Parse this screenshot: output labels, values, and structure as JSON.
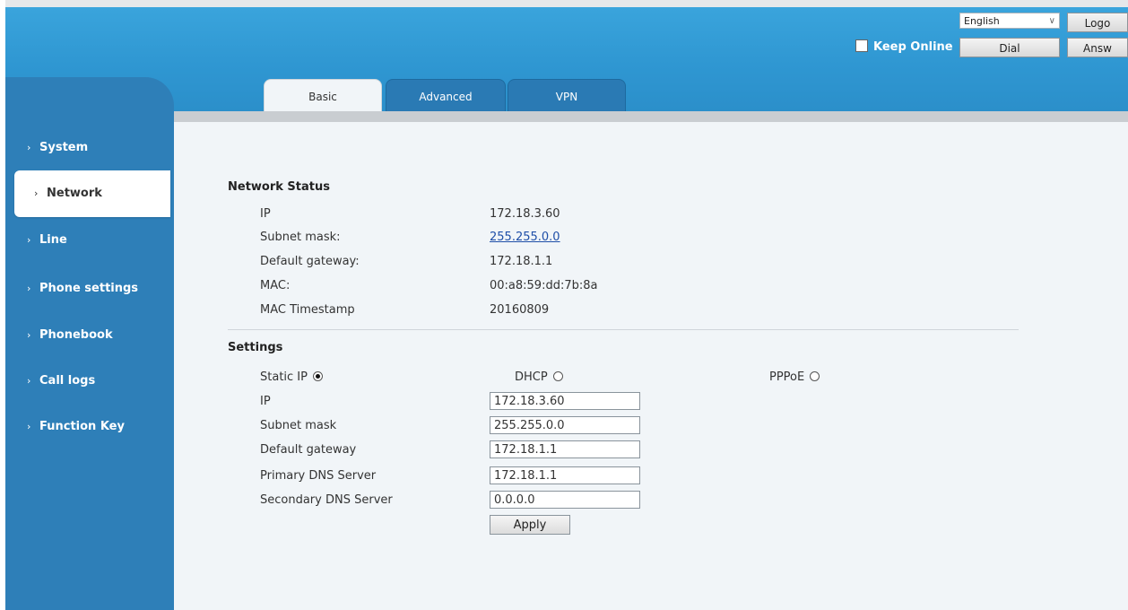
{
  "header": {
    "language": "English",
    "logout_label": "Logo",
    "dial_label": "Dial",
    "answer_label": "Answ",
    "keep_online_label": "Keep Online"
  },
  "tabs": [
    {
      "label": "Basic",
      "active": true
    },
    {
      "label": "Advanced",
      "active": false
    },
    {
      "label": "VPN",
      "active": false
    }
  ],
  "sidebar": {
    "items": [
      {
        "label": "System",
        "active": false
      },
      {
        "label": "Network",
        "active": true
      },
      {
        "label": "Line",
        "active": false
      },
      {
        "label": "Phone settings",
        "active": false
      },
      {
        "label": "Phonebook",
        "active": false
      },
      {
        "label": "Call logs",
        "active": false
      },
      {
        "label": "Function Key",
        "active": false
      }
    ]
  },
  "network_status": {
    "title": "Network Status",
    "rows": [
      {
        "label": "IP",
        "value": "172.18.3.60"
      },
      {
        "label": "Subnet mask:",
        "value": "255.255.0.0"
      },
      {
        "label": "Default gateway:",
        "value": "172.18.1.1"
      },
      {
        "label": "MAC:",
        "value": "00:a8:59:dd:7b:8a"
      },
      {
        "label": "MAC Timestamp",
        "value": "20160809"
      }
    ]
  },
  "settings": {
    "title": "Settings",
    "modes": [
      {
        "label": "Static IP",
        "checked": true
      },
      {
        "label": "DHCP",
        "checked": false
      },
      {
        "label": "PPPoE",
        "checked": false
      }
    ],
    "fields": [
      {
        "label": "IP",
        "value": "172.18.3.60"
      },
      {
        "label": "Subnet mask",
        "value": "255.255.0.0"
      },
      {
        "label": "Default gateway",
        "value": "172.18.1.1"
      },
      {
        "label": "Primary DNS Server",
        "value": "172.18.1.1"
      },
      {
        "label": "Secondary DNS Server",
        "value": "0.0.0.0"
      }
    ],
    "apply_label": "Apply"
  },
  "colors": {
    "header": "#2f97d2",
    "sidebar": "#2e7fb8",
    "content_bg": "#f1f5f8"
  }
}
